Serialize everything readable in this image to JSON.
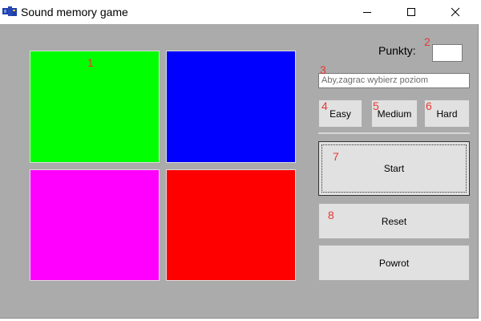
{
  "window": {
    "title": "Sound memory game"
  },
  "colors": {
    "tile_green": "#00ff00",
    "tile_blue": "#0000ff",
    "tile_magenta": "#ff00ff",
    "tile_red": "#ff0000"
  },
  "score": {
    "label": "Punkty:",
    "value": ""
  },
  "level_prompt": "Aby,zagrac wybierz poziom",
  "levels": {
    "easy": "Easy",
    "medium": "Medium",
    "hard": "Hard"
  },
  "actions": {
    "start": "Start",
    "reset": "Reset",
    "back": "Powrot"
  },
  "markers": [
    "1",
    "2",
    "3",
    "4",
    "5",
    "6",
    "7",
    "8"
  ]
}
